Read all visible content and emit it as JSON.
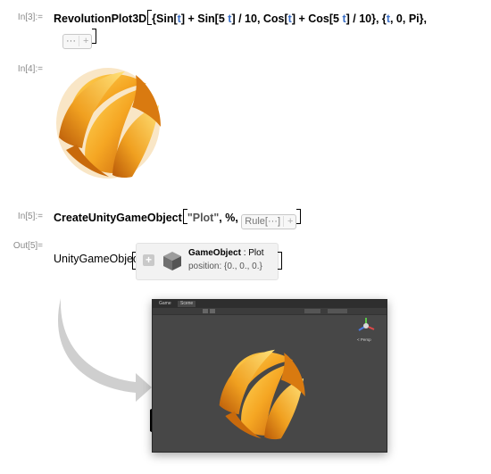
{
  "cells": {
    "in3": {
      "label": "In[3]:=",
      "func": "RevolutionPlot3D",
      "arg_a": "{Sin[",
      "t1": "t",
      "arg_b": "] + Sin[5 ",
      "t2": "t",
      "arg_c": "] / 10, Cos[",
      "t3": "t",
      "arg_d": "] + Cos[5 ",
      "t4": "t",
      "arg_e": "] / 10}, {",
      "t5": "t",
      "arg_f": ", 0, Pi},",
      "options_chip": "···"
    },
    "in4": {
      "label": "In[4]:="
    },
    "in5": {
      "label": "In[5]:=",
      "func": "CreateUnityGameObject",
      "str_arg": "\"Plot\"",
      "mid": ", %, ",
      "rule_chip": "Rule[···]"
    },
    "out5": {
      "label": "Out[5]=",
      "head": "UnityGameObject",
      "go_title": "GameObject",
      "go_sep": " : ",
      "go_name": "Plot",
      "position_label": "position: ",
      "position_value": "{0., 0., 0.}"
    }
  },
  "unity_editor": {
    "tabs": [
      "Game",
      "Scene"
    ],
    "gizmo_label": "< Persp",
    "background": "#474747"
  },
  "colors": {
    "accent_orange": "#f5a623",
    "variable_blue": "#3b6fc7",
    "label_gray": "#8a8a8a"
  },
  "icons": [
    "plus-icon",
    "cube-icon",
    "unity-logo-icon",
    "curved-arrow-icon",
    "scene-gizmo-icon"
  ]
}
